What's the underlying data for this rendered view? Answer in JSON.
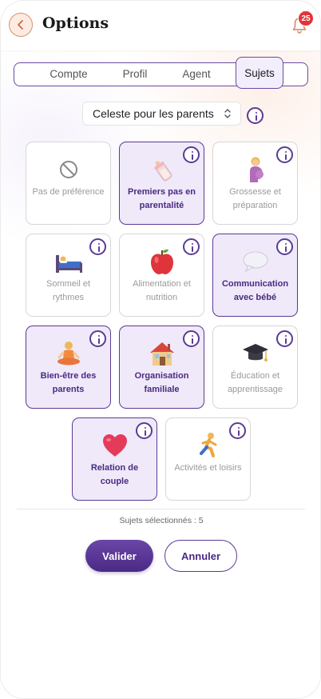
{
  "header": {
    "title": "Options",
    "notification_count": "25",
    "back_icon": "chevron-left-icon",
    "bell_icon": "bell-icon"
  },
  "tabs": [
    {
      "label": "Compte",
      "active": false
    },
    {
      "label": "Profil",
      "active": false
    },
    {
      "label": "Agent",
      "active": false
    },
    {
      "label": "Sujets",
      "active": true
    }
  ],
  "agent_select": {
    "value": "Celeste pour les parents"
  },
  "topics": [
    {
      "label": "Pas de préférence",
      "selected": false,
      "icon": "no-preference-icon"
    },
    {
      "label": "Premiers pas en parentalité",
      "selected": true,
      "icon": "baby-bottle-icon"
    },
    {
      "label": "Grossesse et préparation",
      "selected": false,
      "icon": "pregnant-woman-icon"
    },
    {
      "label": "Sommeil et rythmes",
      "selected": false,
      "icon": "bed-icon"
    },
    {
      "label": "Alimentation et nutrition",
      "selected": false,
      "icon": "apple-icon"
    },
    {
      "label": "Communication avec bébé",
      "selected": true,
      "icon": "speech-bubble-icon"
    },
    {
      "label": "Bien-être des parents",
      "selected": true,
      "icon": "meditation-icon"
    },
    {
      "label": "Organisation familiale",
      "selected": true,
      "icon": "house-icon"
    },
    {
      "label": "Éducation et apprentissage",
      "selected": false,
      "icon": "graduation-cap-icon"
    },
    {
      "label": "Relation de couple",
      "selected": true,
      "icon": "heart-icon"
    },
    {
      "label": "Activités et loisirs",
      "selected": false,
      "icon": "running-person-icon"
    }
  ],
  "footer": {
    "count_text": "Sujets sélectionnés : 5",
    "validate_label": "Valider",
    "cancel_label": "Annuler"
  },
  "colors": {
    "accent": "#5b3a94",
    "selected_bg": "#efe9fa",
    "badge": "#e0343b",
    "back_button": "#d9916a"
  }
}
